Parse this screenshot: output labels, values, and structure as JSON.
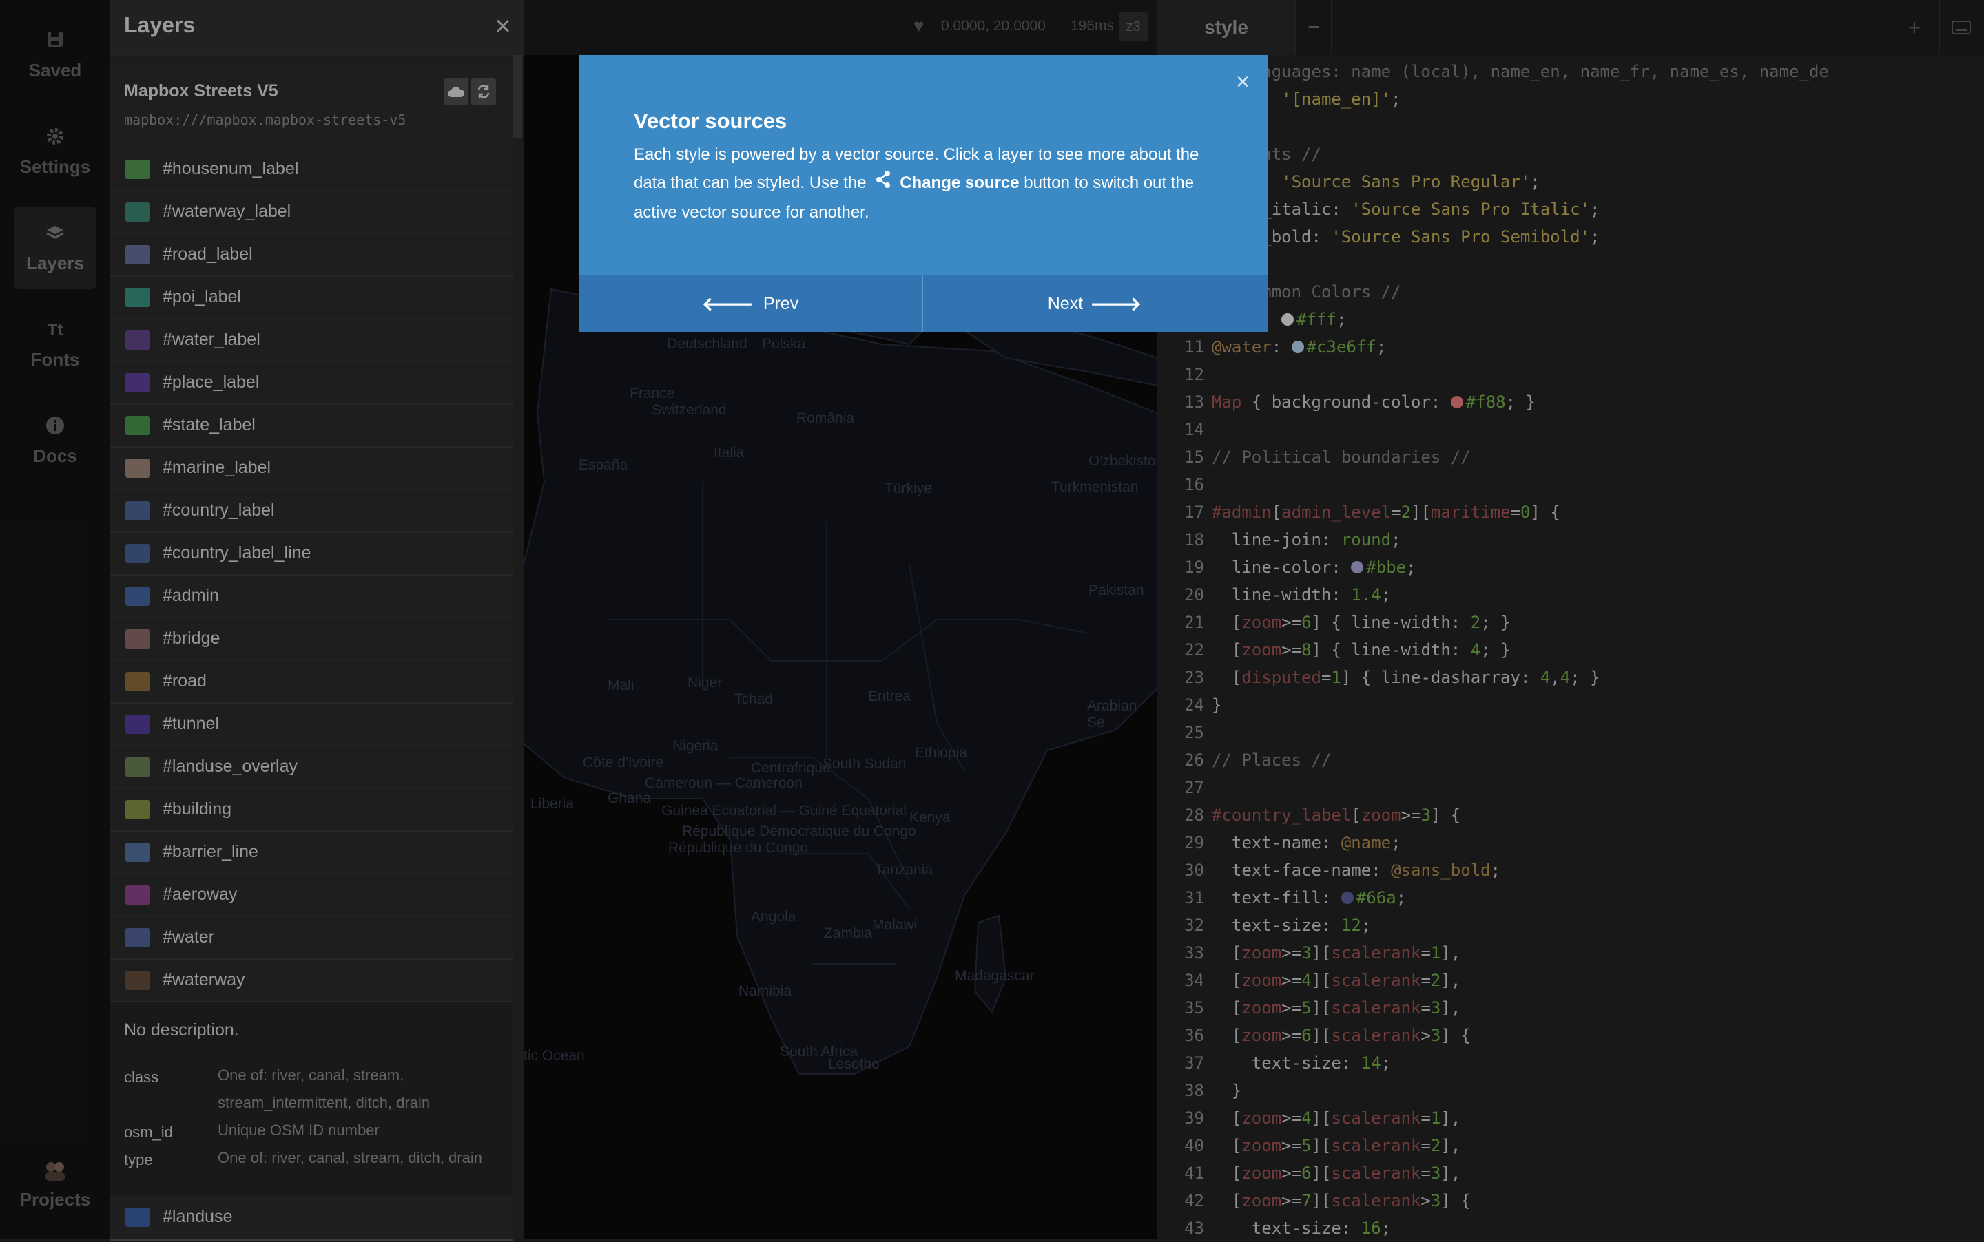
{
  "nav": {
    "saved": "Saved",
    "settings": "Settings",
    "layers": "Layers",
    "fonts": "Fonts",
    "docs": "Docs",
    "projects": "Projects"
  },
  "layers_panel": {
    "title": "Layers",
    "close": "×",
    "source_name": "Mapbox Streets V5",
    "source_url": "mapbox:///mapbox.mapbox-streets-v5",
    "layers": [
      {
        "name": "#housenum_label",
        "color": "#5aa35a"
      },
      {
        "name": "#waterway_label",
        "color": "#3f8f7a"
      },
      {
        "name": "#road_label",
        "color": "#6b7aa6"
      },
      {
        "name": "#poi_label",
        "color": "#3e9c8c"
      },
      {
        "name": "#water_label",
        "color": "#6a4a94"
      },
      {
        "name": "#place_label",
        "color": "#6a44a8"
      },
      {
        "name": "#state_label",
        "color": "#4ea04e"
      },
      {
        "name": "#marine_label",
        "color": "#a8907f"
      },
      {
        "name": "#country_label",
        "color": "#556aa0"
      },
      {
        "name": "#country_label_line",
        "color": "#4a6aa0"
      },
      {
        "name": "#admin",
        "color": "#4a6eb0"
      },
      {
        "name": "#bridge",
        "color": "#9a7070"
      },
      {
        "name": "#road",
        "color": "#97733f"
      },
      {
        "name": "#tunnel",
        "color": "#5b43a6"
      },
      {
        "name": "#landuse_overlay",
        "color": "#6f8a5a"
      },
      {
        "name": "#building",
        "color": "#8f9a4a"
      },
      {
        "name": "#barrier_line",
        "color": "#5a7aaa"
      },
      {
        "name": "#aeroway",
        "color": "#9a4a9a"
      },
      {
        "name": "#water",
        "color": "#5a6aa6"
      },
      {
        "name": "#waterway",
        "color": "#6a5440"
      }
    ],
    "details": {
      "description": "No description.",
      "fields": [
        {
          "key": "class",
          "value": "One of: river, canal, stream, stream_intermittent, ditch, drain"
        },
        {
          "key": "osm_id",
          "value": "Unique OSM ID number"
        },
        {
          "key": "type",
          "value": "One of: river, canal, stream, ditch, drain"
        }
      ]
    },
    "last_layer": {
      "name": "#landuse",
      "color": "#3e66b0"
    }
  },
  "map": {
    "coords": "0.0000, 20.0000",
    "render_time": "196ms",
    "zoom": "z3",
    "labels": [
      "Deutschland",
      "Polska",
      "France",
      "Switzerland",
      "România",
      "Italia",
      "España",
      "Türkiye",
      "Turkmenistan",
      "Pakistan",
      "Mali",
      "Niger",
      "Tchad",
      "Eritrea",
      "Ethiopia",
      "Arabian Se",
      "Nigeria",
      "Cameroun",
      "Cameroon",
      "South Sudan",
      "Guinea Ecuatorial",
      "Guiné Equatorial",
      "République Démocratique du Congo",
      "République du Congo",
      "Kenya",
      "Tanzania",
      "Angola",
      "Zambia",
      "Malawi",
      "Namibia",
      "Madagascar",
      "South Africa",
      "Lesotho",
      "tic Ocean",
      "Ghana",
      "Liberia",
      "Côte d'Ivoire",
      "Centrafrique",
      "O'zbekiston"
    ]
  },
  "editor": {
    "tab": "style",
    "tab_close": "−",
    "add": "+",
    "lines": [
      {
        "n": "",
        "html": "<span class='cm'>// Languages: name (local), name_en, name_fr, name_es, name_de</span>"
      },
      {
        "n": "",
        "html": "@name: <span class='tok-str'>'[name_en]'</span>;"
      },
      {
        "n": "",
        "html": ""
      },
      {
        "n": "",
        "html": "<span class='cm'>// Fonts //</span>"
      },
      {
        "n": "",
        "html": "@sans: <span class='tok-str'>'Source Sans Pro Regular'</span>;"
      },
      {
        "n": "",
        "html": "@sans_italic: <span class='tok-str'>'Source Sans Pro Italic'</span>;"
      },
      {
        "n": "",
        "html": "@sans_bold: <span class='tok-str'>'Source Sans Pro Semibold'</span>;"
      },
      {
        "n": "",
        "html": ""
      },
      {
        "n": "",
        "html": "<span class='cm'>// Common Colors //</span>"
      },
      {
        "n": "",
        "html": "@land: <span class='dot' style='background:#fff'></span><span class='tok-num'>#fff</span>;"
      },
      {
        "n": "11",
        "html": "<span class='tok-var'>@water</span>: <span class='dot' style='background:#c3e6ff'></span><span class='tok-num'>#c3e6ff</span>;"
      },
      {
        "n": "12",
        "html": ""
      },
      {
        "n": "13",
        "html": "<span class='tok-sel'>Map</span> { background-color: <span class='dot' style='background:#f88'></span><span class='tok-num'>#f88</span>; }"
      },
      {
        "n": "14",
        "html": ""
      },
      {
        "n": "15",
        "html": "<span class='cm'>// Political boundaries //</span>"
      },
      {
        "n": "16",
        "html": ""
      },
      {
        "n": "17",
        "html": "<span class='tok-sel'>#admin</span>[<span class='tok-sel'>admin_level</span>=<span class='tok-num'>2</span>][<span class='tok-sel'>maritime</span>=<span class='tok-num'>0</span>] {"
      },
      {
        "n": "18",
        "html": "  line-join: <span class='tok-num'>round</span>;"
      },
      {
        "n": "19",
        "html": "  line-color: <span class='dot' style='background:#bbe'></span><span class='tok-num'>#bbe</span>;"
      },
      {
        "n": "20",
        "html": "  line-width: <span class='tok-num'>1.4</span>;"
      },
      {
        "n": "21",
        "html": "  [<span class='tok-sel'>zoom</span>&gt;=<span class='tok-num'>6</span>] { line-width: <span class='tok-num'>2</span>; }"
      },
      {
        "n": "22",
        "html": "  [<span class='tok-sel'>zoom</span>&gt;=<span class='tok-num'>8</span>] { line-width: <span class='tok-num'>4</span>; }"
      },
      {
        "n": "23",
        "html": "  [<span class='tok-sel'>disputed</span>=<span class='tok-num'>1</span>] { line-dasharray: <span class='tok-num'>4</span>,<span class='tok-num'>4</span>; }"
      },
      {
        "n": "24",
        "html": "}"
      },
      {
        "n": "25",
        "html": ""
      },
      {
        "n": "26",
        "html": "<span class='cm'>// Places //</span>"
      },
      {
        "n": "27",
        "html": ""
      },
      {
        "n": "28",
        "html": "<span class='tok-sel'>#country_label</span>[<span class='tok-sel'>zoom</span>&gt;=<span class='tok-num'>3</span>] {"
      },
      {
        "n": "29",
        "html": "  text-name: <span class='tok-var'>@name</span>;"
      },
      {
        "n": "30",
        "html": "  text-face-name: <span class='tok-var'>@sans_bold</span>;"
      },
      {
        "n": "31",
        "html": "  text-fill: <span class='dot' style='background:#66a'></span><span class='tok-num'>#66a</span>;"
      },
      {
        "n": "32",
        "html": "  text-size: <span class='tok-num'>12</span>;"
      },
      {
        "n": "33",
        "html": "  [<span class='tok-sel'>zoom</span>&gt;=<span class='tok-num'>3</span>][<span class='tok-sel'>scalerank</span>=<span class='tok-num'>1</span>],"
      },
      {
        "n": "34",
        "html": "  [<span class='tok-sel'>zoom</span>&gt;=<span class='tok-num'>4</span>][<span class='tok-sel'>scalerank</span>=<span class='tok-num'>2</span>],"
      },
      {
        "n": "35",
        "html": "  [<span class='tok-sel'>zoom</span>&gt;=<span class='tok-num'>5</span>][<span class='tok-sel'>scalerank</span>=<span class='tok-num'>3</span>],"
      },
      {
        "n": "36",
        "html": "  [<span class='tok-sel'>zoom</span>&gt;=<span class='tok-num'>6</span>][<span class='tok-sel'>scalerank</span>&gt;<span class='tok-num'>3</span>] {"
      },
      {
        "n": "37",
        "html": "    text-size: <span class='tok-num'>14</span>;"
      },
      {
        "n": "38",
        "html": "  }"
      },
      {
        "n": "39",
        "html": "  [<span class='tok-sel'>zoom</span>&gt;=<span class='tok-num'>4</span>][<span class='tok-sel'>scalerank</span>=<span class='tok-num'>1</span>],"
      },
      {
        "n": "40",
        "html": "  [<span class='tok-sel'>zoom</span>&gt;=<span class='tok-num'>5</span>][<span class='tok-sel'>scalerank</span>=<span class='tok-num'>2</span>],"
      },
      {
        "n": "41",
        "html": "  [<span class='tok-sel'>zoom</span>&gt;=<span class='tok-num'>6</span>][<span class='tok-sel'>scalerank</span>=<span class='tok-num'>3</span>],"
      },
      {
        "n": "42",
        "html": "  [<span class='tok-sel'>zoom</span>&gt;=<span class='tok-num'>7</span>][<span class='tok-sel'>scalerank</span>&gt;<span class='tok-num'>3</span>] {"
      },
      {
        "n": "43",
        "html": "    text-size: <span class='tok-num'>16</span>;"
      }
    ]
  },
  "modal": {
    "close": "×",
    "title": "Vector sources",
    "body_before": "Each style is powered by a vector source. Click a layer to see more about the data that can be styled. Use the ",
    "body_button": "Change source",
    "body_after": " button to switch out the active vector source for another.",
    "prev": "Prev",
    "next": "Next"
  }
}
